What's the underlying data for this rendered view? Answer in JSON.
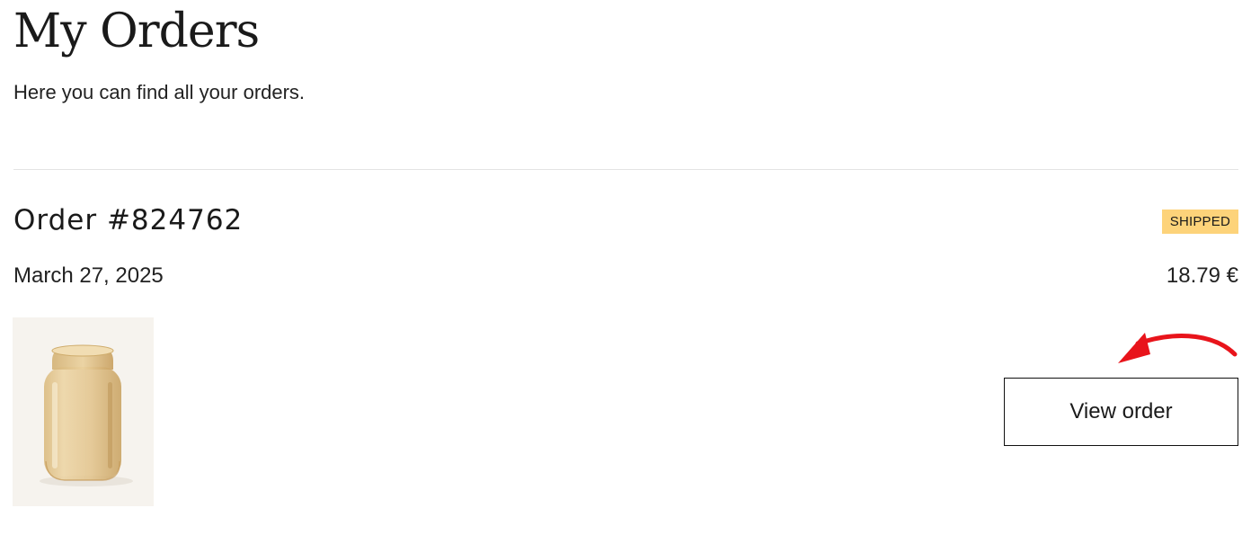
{
  "header": {
    "title": "My Orders",
    "subtitle": "Here you can find all your orders."
  },
  "orders": [
    {
      "number_label": "Order #824762",
      "status": "SHIPPED",
      "date": "March 27, 2025",
      "total": "18.79 €",
      "product_image": "amber-glass-vase",
      "view_button_label": "View order"
    }
  ],
  "colors": {
    "status_badge": "#fdd37a",
    "annotation_arrow": "#e8141b",
    "divider": "#e3e3e3"
  },
  "icons": {
    "annotation": "red-curved-arrow-icon"
  }
}
